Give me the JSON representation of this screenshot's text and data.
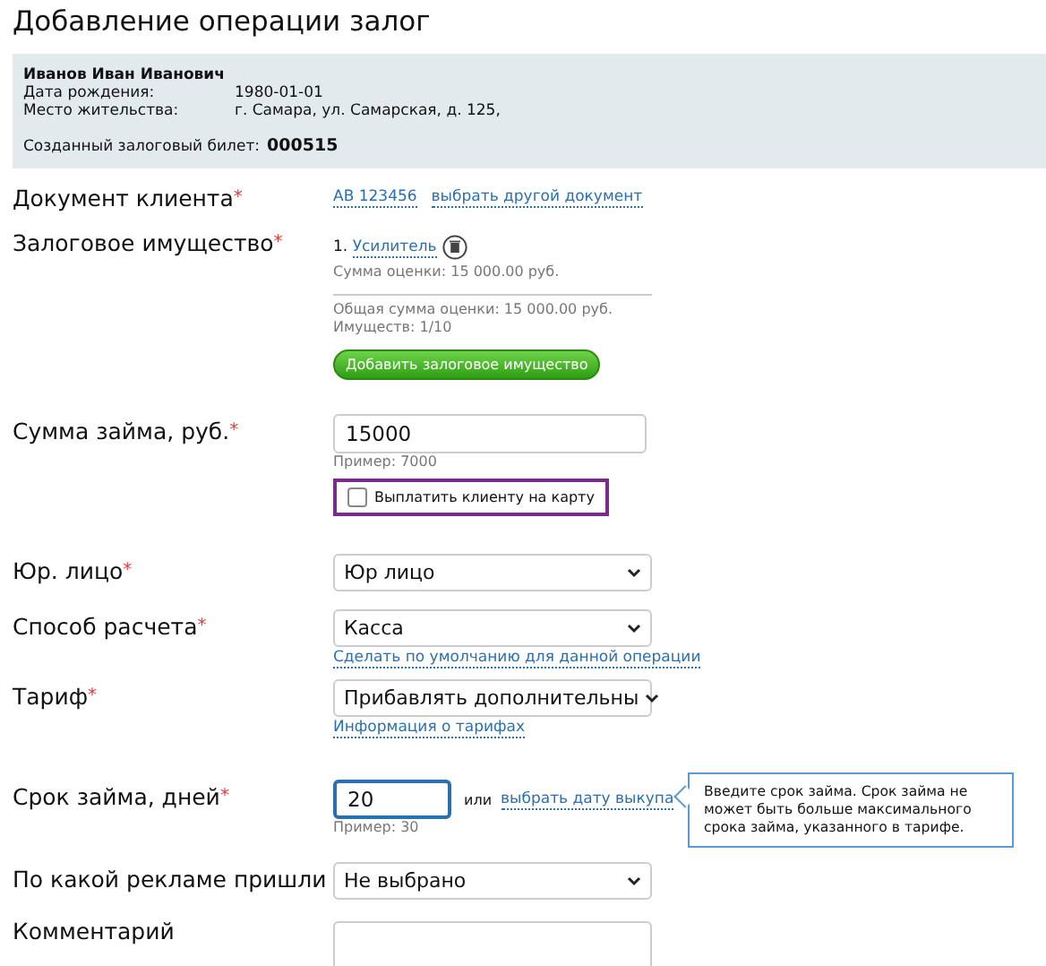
{
  "title": "Добавление операции залог",
  "client": {
    "name": "Иванов Иван Иванович",
    "fields": [
      {
        "label": "Дата рождения:",
        "value": "1980-01-01"
      },
      {
        "label": "Место жительства:",
        "value": "г. Самара, ул. Самарская, д. 125,"
      }
    ],
    "ticket_label": "Созданный залоговый билет:",
    "ticket_number": "000515"
  },
  "rows": [
    {
      "kind": "document",
      "label": "Документ клиента",
      "required_mark": "*",
      "value": "АВ 123456",
      "link": "выбрать другой документ"
    },
    {
      "kind": "collateral",
      "label": "Залоговое имущество",
      "required_mark": "*",
      "items": [
        {
          "number": "1.",
          "name": "Усилитель",
          "appraisal": "Сумма оценки: 15 000.00 руб."
        }
      ],
      "total": "Общая сумма оценки: 15 000.00 руб.",
      "count": "Имуществ: 1/10",
      "button": "Добавить залоговое имущество"
    },
    {
      "kind": "amount",
      "label": "Сумма займа, руб.",
      "required_mark": "*",
      "value": "15000",
      "hint": "Пример: 7000",
      "checkbox": {
        "label": "Выплатить клиенту на карту",
        "checked": false
      }
    },
    {
      "kind": "select",
      "label": "Юр. лицо",
      "required_mark": "*",
      "value": "Юр лицо"
    },
    {
      "kind": "select",
      "label": "Способ расчета",
      "required_mark": "*",
      "value": "Касса",
      "link": "Сделать по умолчанию для данной операции"
    },
    {
      "kind": "select",
      "label": "Тариф",
      "required_mark": "*",
      "value": "Прибавлять дополнительны",
      "link": "Информация о тарифах"
    },
    {
      "kind": "term",
      "label": "Срок займа, дней",
      "required_mark": "*",
      "value": "20",
      "hint": "Пример: 30",
      "or": "или",
      "link": "выбрать дату выкупа",
      "tooltip": "Введите срок займа. Срок займа не может быть больше максимального срока займа, указанного в тарифе."
    },
    {
      "kind": "select",
      "label": "По какой рекламе пришли",
      "value": "Не выбрано"
    },
    {
      "kind": "comment",
      "label": "Комментарий"
    }
  ]
}
